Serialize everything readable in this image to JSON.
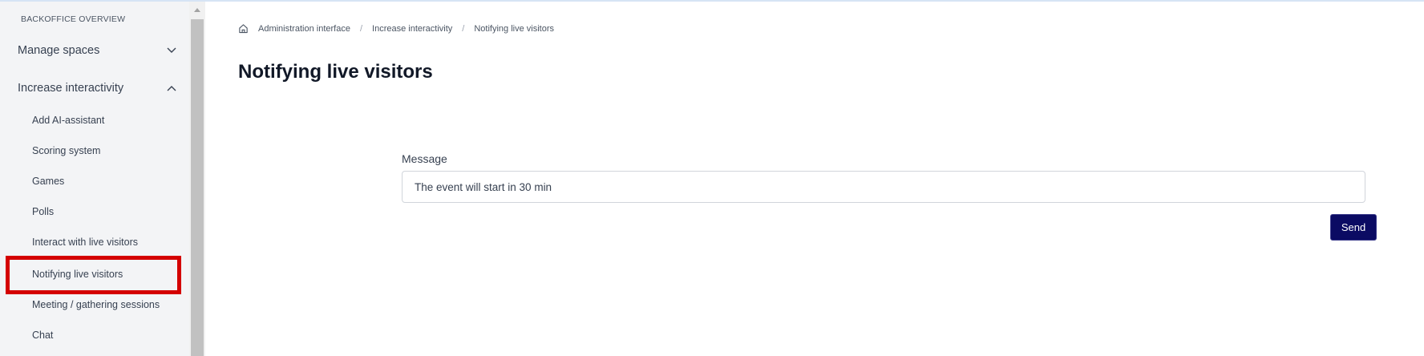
{
  "sidebar": {
    "header": "BACKOFFICE OVERVIEW",
    "sections": [
      {
        "label": "Manage spaces",
        "expanded": false
      },
      {
        "label": "Increase interactivity",
        "expanded": true
      }
    ],
    "items": [
      {
        "label": "Add AI-assistant"
      },
      {
        "label": "Scoring system"
      },
      {
        "label": "Games"
      },
      {
        "label": "Polls"
      },
      {
        "label": "Interact with live visitors"
      },
      {
        "label": "Notifying live visitors",
        "selected": true
      },
      {
        "label": "Meeting / gathering sessions"
      },
      {
        "label": "Chat"
      }
    ]
  },
  "breadcrumb": {
    "items": [
      "Administration interface",
      "Increase interactivity",
      "Notifying live visitors"
    ],
    "separator": "/"
  },
  "main": {
    "title": "Notifying live visitors",
    "message_label": "Message",
    "message_value": "The event will start in 30 min",
    "send_label": "Send"
  },
  "colors": {
    "highlight": "#d40000",
    "send_button": "#0b0b63",
    "sidebar_bg": "#f3f4f6"
  }
}
